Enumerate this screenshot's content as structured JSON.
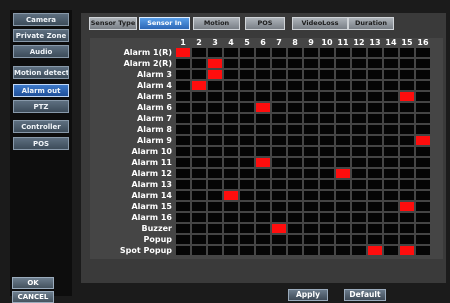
{
  "sidebar": {
    "items": [
      {
        "label": "Camera",
        "active": false
      },
      {
        "label": "Private Zone",
        "active": false
      },
      {
        "label": "Audio",
        "active": false
      },
      {
        "label": "Motion detection",
        "active": false
      },
      {
        "label": "Alarm out",
        "active": true
      },
      {
        "label": "PTZ",
        "active": false
      },
      {
        "label": "Controller",
        "active": false
      },
      {
        "label": "POS",
        "active": false
      }
    ],
    "ok_label": "OK",
    "cancel_label": "CANCEL"
  },
  "tabs": [
    {
      "label": "Sensor Type",
      "active": false
    },
    {
      "label": "Sensor In",
      "active": true
    },
    {
      "label": "Motion",
      "active": false
    },
    {
      "label": "POS",
      "active": false
    },
    {
      "label": "VideoLoss",
      "active": false
    },
    {
      "label": "Duration",
      "active": false
    }
  ],
  "grid": {
    "columns": [
      "1",
      "2",
      "3",
      "4",
      "5",
      "6",
      "7",
      "8",
      "9",
      "10",
      "11",
      "12",
      "13",
      "14",
      "15",
      "16"
    ],
    "rows": [
      {
        "label": "Alarm 1(R)",
        "on": [
          1
        ]
      },
      {
        "label": "Alarm 2(R)",
        "on": [
          3
        ]
      },
      {
        "label": "Alarm 3",
        "on": [
          3
        ]
      },
      {
        "label": "Alarm 4",
        "on": [
          2
        ]
      },
      {
        "label": "Alarm 5",
        "on": [
          15
        ]
      },
      {
        "label": "Alarm 6",
        "on": [
          6
        ]
      },
      {
        "label": "Alarm 7",
        "on": []
      },
      {
        "label": "Alarm 8",
        "on": []
      },
      {
        "label": "Alarm 9",
        "on": [
          16
        ]
      },
      {
        "label": "Alarm 10",
        "on": []
      },
      {
        "label": "Alarm 11",
        "on": [
          6
        ]
      },
      {
        "label": "Alarm 12",
        "on": [
          11
        ]
      },
      {
        "label": "Alarm 13",
        "on": []
      },
      {
        "label": "Alarm 14",
        "on": [
          4
        ]
      },
      {
        "label": "Alarm 15",
        "on": [
          15
        ]
      },
      {
        "label": "Alarm 16",
        "on": []
      },
      {
        "label": "Buzzer",
        "on": [
          7
        ]
      },
      {
        "label": "Popup",
        "on": []
      },
      {
        "label": "Spot Popup",
        "on": [
          13,
          15
        ]
      }
    ]
  },
  "footer": {
    "apply_label": "Apply",
    "default_label": "Default"
  },
  "colors": {
    "active_cell": "#ff0d0d",
    "inactive_cell": "#050505",
    "active_item": "#2f6bc0"
  }
}
